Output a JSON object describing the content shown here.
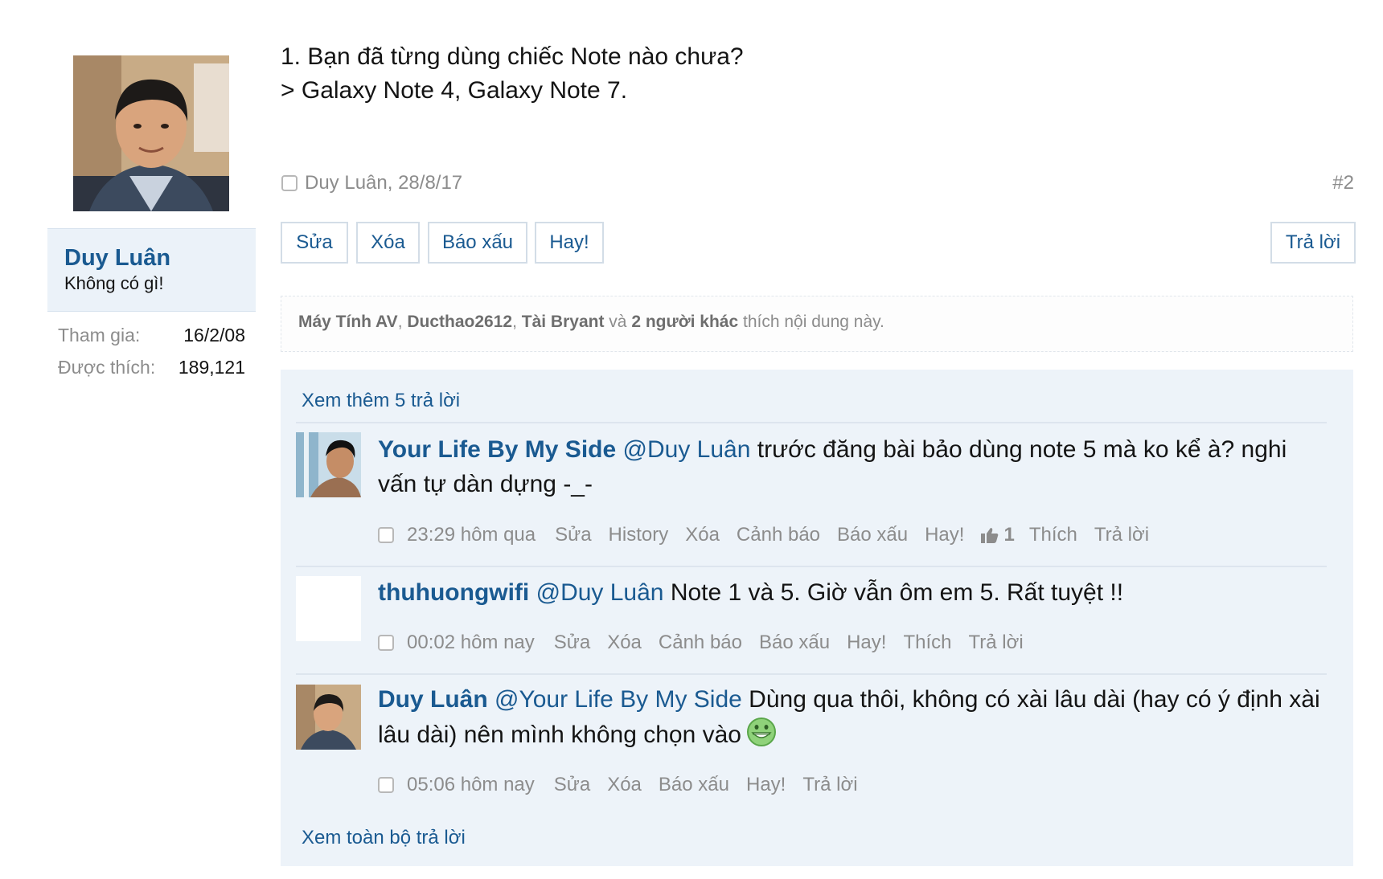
{
  "user": {
    "name": "Duy Luân",
    "title": "Không có gì!",
    "stats": [
      {
        "label": "Tham gia:",
        "value": "16/2/08"
      },
      {
        "label": "Được thích:",
        "value": "189,121"
      }
    ]
  },
  "post": {
    "lines": [
      "1. Bạn đã từng dùng chiếc Note nào chưa?",
      "> Galaxy Note 4, Galaxy Note 7."
    ],
    "meta": "Duy Luân, 28/8/17",
    "number": "#2",
    "actions": [
      "Sửa",
      "Xóa",
      "Báo xấu",
      "Hay!"
    ],
    "reply_label": "Trả lời",
    "likes": {
      "names": [
        "Máy Tính AV",
        "Ducthao2612",
        "Tài Bryant"
      ],
      "sep1": ", ",
      "sep2": ", ",
      "and_text": " và ",
      "others": "2 người khác",
      "suffix": " thích nội dung này."
    }
  },
  "comments": {
    "show_more": "Xem thêm 5 trả lời",
    "show_all": "Xem toàn bộ trả lời",
    "items": [
      {
        "author": "Your Life By My Side",
        "mention": "@Duy Luân",
        "text": " trước đăng bài bảo dùng note 5 mà ko kể à? nghi vấn tự dàn dựng -_-",
        "time": "23:29 hôm qua",
        "actions": [
          "Sửa",
          "History",
          "Xóa",
          "Cảnh báo",
          "Báo xấu",
          "Hay!"
        ],
        "like_count": "1",
        "tail_actions": [
          "Thích",
          "Trả lời"
        ]
      },
      {
        "author": "thuhuongwifi",
        "mention": "@Duy Luân",
        "text": " Note 1 và 5. Giờ vẫn ôm em 5. Rất tuyệt !!",
        "time": "00:02 hôm nay",
        "actions": [
          "Sửa",
          "Xóa",
          "Cảnh báo",
          "Báo xấu",
          "Hay!",
          "Thích",
          "Trả lời"
        ]
      },
      {
        "author": "Duy Luân",
        "mention": "@Your Life By My Side",
        "text": " Dùng qua thôi, không có xài lâu dài (hay có ý định xài lâu dài) nên mình không chọn vào",
        "emoji": "grin-emoji",
        "time": "05:06 hôm nay",
        "actions": [
          "Sửa",
          "Xóa",
          "Báo xấu",
          "Hay!",
          "Trả lời"
        ]
      }
    ]
  },
  "colors": {
    "link": "#1a5a91",
    "muted": "#8c8c8c",
    "panel": "#ebf2f9",
    "comments_bg": "#edf3f9"
  }
}
